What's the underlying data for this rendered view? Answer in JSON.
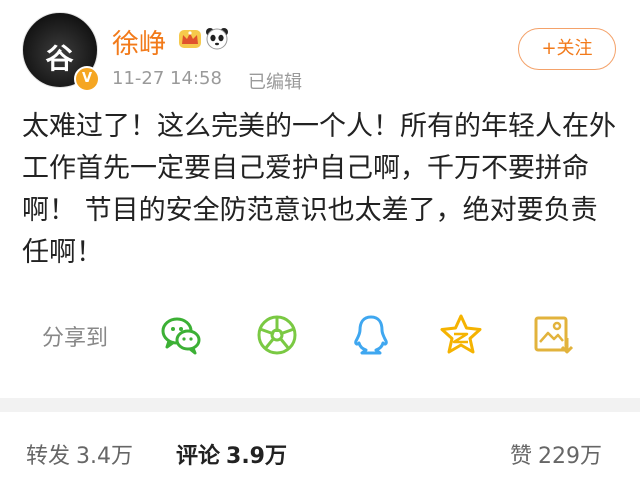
{
  "post": {
    "author": {
      "name": "徐峥",
      "avatar_char": "谷",
      "badges": [
        "crown-icon",
        "panda-icon"
      ],
      "verified_color": "#f5a623"
    },
    "time": "11-27 14:58",
    "edited_label": "已编辑",
    "follow_label": "+关注",
    "text": "太难过了！这么完美的一个人！所有的年轻人在外工作首先一定要自己爱护自己啊，千万不要拼命啊！ 节目的安全防范意识也太差了，绝对要负责任啊！"
  },
  "share": {
    "label": "分享到",
    "targets": [
      "wechat-icon",
      "moments-icon",
      "qq-icon",
      "qzone-icon",
      "save-image-icon"
    ],
    "colors": {
      "green": "#3cb035",
      "lime": "#7ac943",
      "blue": "#3fa7f0",
      "yellow": "#f5b301",
      "gold": "#e2b33c"
    }
  },
  "stats": {
    "repost_label": "转发",
    "repost_count": "3.4万",
    "comment_label": "评论",
    "comment_count": "3.9万",
    "like_label": "赞",
    "like_count": "229万"
  },
  "theme": {
    "accent": "#f27a1a",
    "text": "#222222",
    "muted": "#9a9a9a"
  }
}
